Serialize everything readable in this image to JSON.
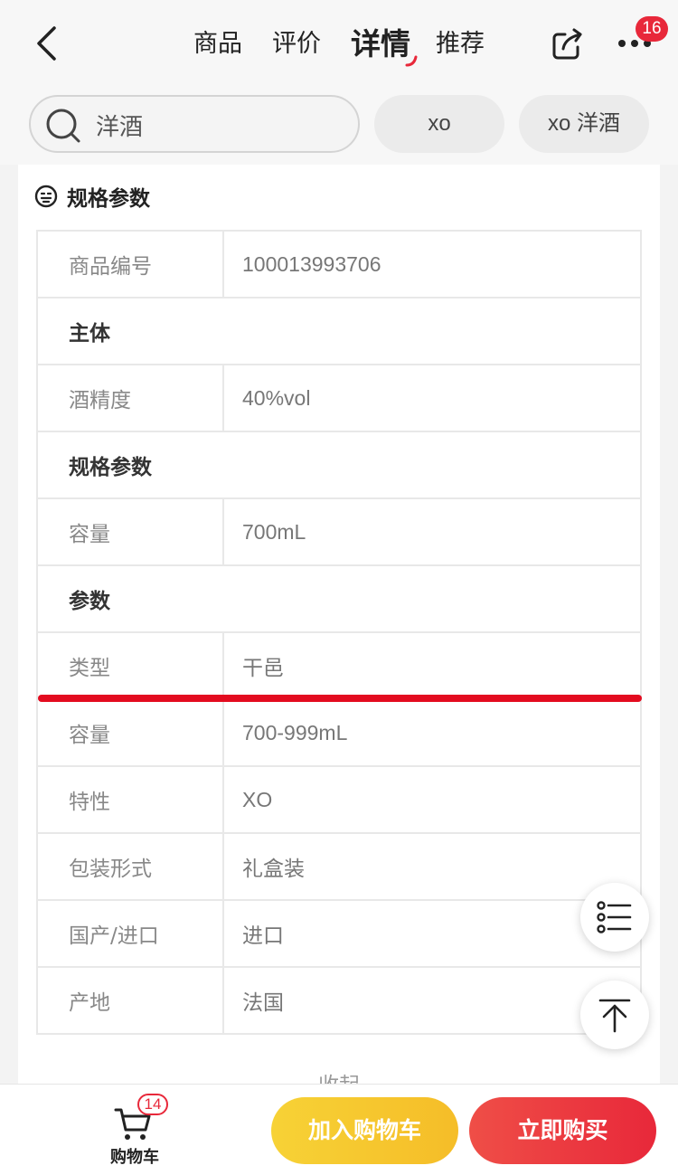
{
  "nav": {
    "tabs": [
      "商品",
      "评价",
      "详情",
      "推荐"
    ],
    "active_tab": "详情",
    "more_badge": "16"
  },
  "search": {
    "query": "洋酒",
    "chips": [
      "xo",
      "xo 洋酒"
    ]
  },
  "spec_section": {
    "title": "规格参数",
    "rows": [
      {
        "key": "商品编号",
        "value": "100013993706"
      },
      {
        "group": "主体"
      },
      {
        "key": "酒精度",
        "value": "40%vol"
      },
      {
        "group": "规格参数"
      },
      {
        "key": "容量",
        "value": "700mL"
      },
      {
        "group": "参数"
      },
      {
        "key": "类型",
        "value": "干邑"
      },
      {
        "key": "容量",
        "value": "700-999mL"
      },
      {
        "key": "特性",
        "value": "XO"
      },
      {
        "key": "包装形式",
        "value": "礼盒装"
      },
      {
        "key": "国产/进口",
        "value": "进口"
      },
      {
        "key": "产地",
        "value": "法国"
      }
    ],
    "collapse_label": "收起"
  },
  "bottom": {
    "cart_label": "购物车",
    "cart_badge": "14",
    "add_to_cart": "加入购物车",
    "buy_now": "立即购买"
  },
  "colors": {
    "accent_red": "#e8283a",
    "cart_yellow": "#f5c52e",
    "annotation_line": "#e30b1f"
  },
  "icons": [
    "back-arrow-icon",
    "share-icon",
    "more-icon",
    "search-icon",
    "spec-icon",
    "list-icon",
    "back-to-top-icon",
    "cart-icon"
  ]
}
